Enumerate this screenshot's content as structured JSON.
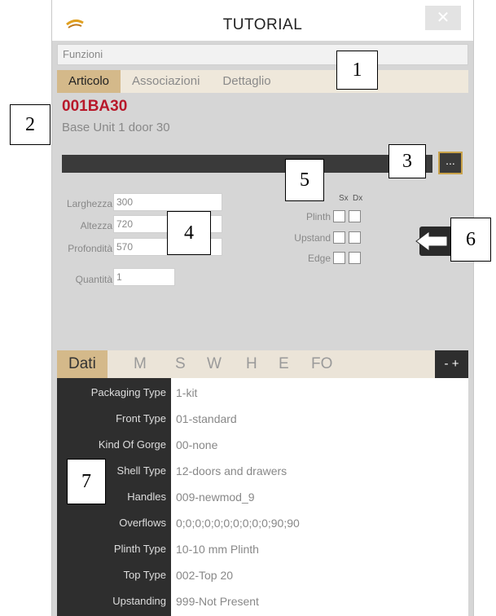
{
  "window": {
    "title": "TUTORIAL",
    "close": "✕"
  },
  "funzioni": "Funzioni",
  "tabs": [
    "Articolo",
    "Associazioni",
    "Dettaglio"
  ],
  "article": {
    "code": "001BA30",
    "description": "Base Unit 1 door 30"
  },
  "dots_button": "...",
  "dimensions": [
    {
      "label": "Larghezza",
      "value": "300"
    },
    {
      "label": "Altezza",
      "value": "720"
    },
    {
      "label": "Profondità",
      "value": "570"
    },
    {
      "label": "Quantità",
      "value": "1"
    }
  ],
  "options": {
    "col_sx": "Sx",
    "col_dx": "Dx",
    "rows": [
      "Plinth",
      "Upstand",
      "Edge"
    ]
  },
  "detail_tabs": [
    "Dati",
    "M",
    "S",
    "W",
    "H",
    "E",
    "FO"
  ],
  "zoom": "- +",
  "properties": [
    {
      "label": "Packaging Type",
      "value": "1-kit"
    },
    {
      "label": "Front Type",
      "value": "01-standard"
    },
    {
      "label": "Kind Of Gorge",
      "value": "00-none"
    },
    {
      "label": "Shell Type",
      "value": "12-doors and drawers"
    },
    {
      "label": "Handles",
      "value": "009-newmod_9"
    },
    {
      "label": "Overflows",
      "value": "0;0;0;0;0;0;0;0;0;0;90;90"
    },
    {
      "label": "Plinth Type",
      "value": "10-10 mm Plinth"
    },
    {
      "label": "Top Type",
      "value": "002-Top 20"
    },
    {
      "label": "Upstanding",
      "value": "999-Not Present"
    }
  ],
  "callouts": [
    "1",
    "2",
    "3",
    "4",
    "5",
    "6",
    "7"
  ]
}
